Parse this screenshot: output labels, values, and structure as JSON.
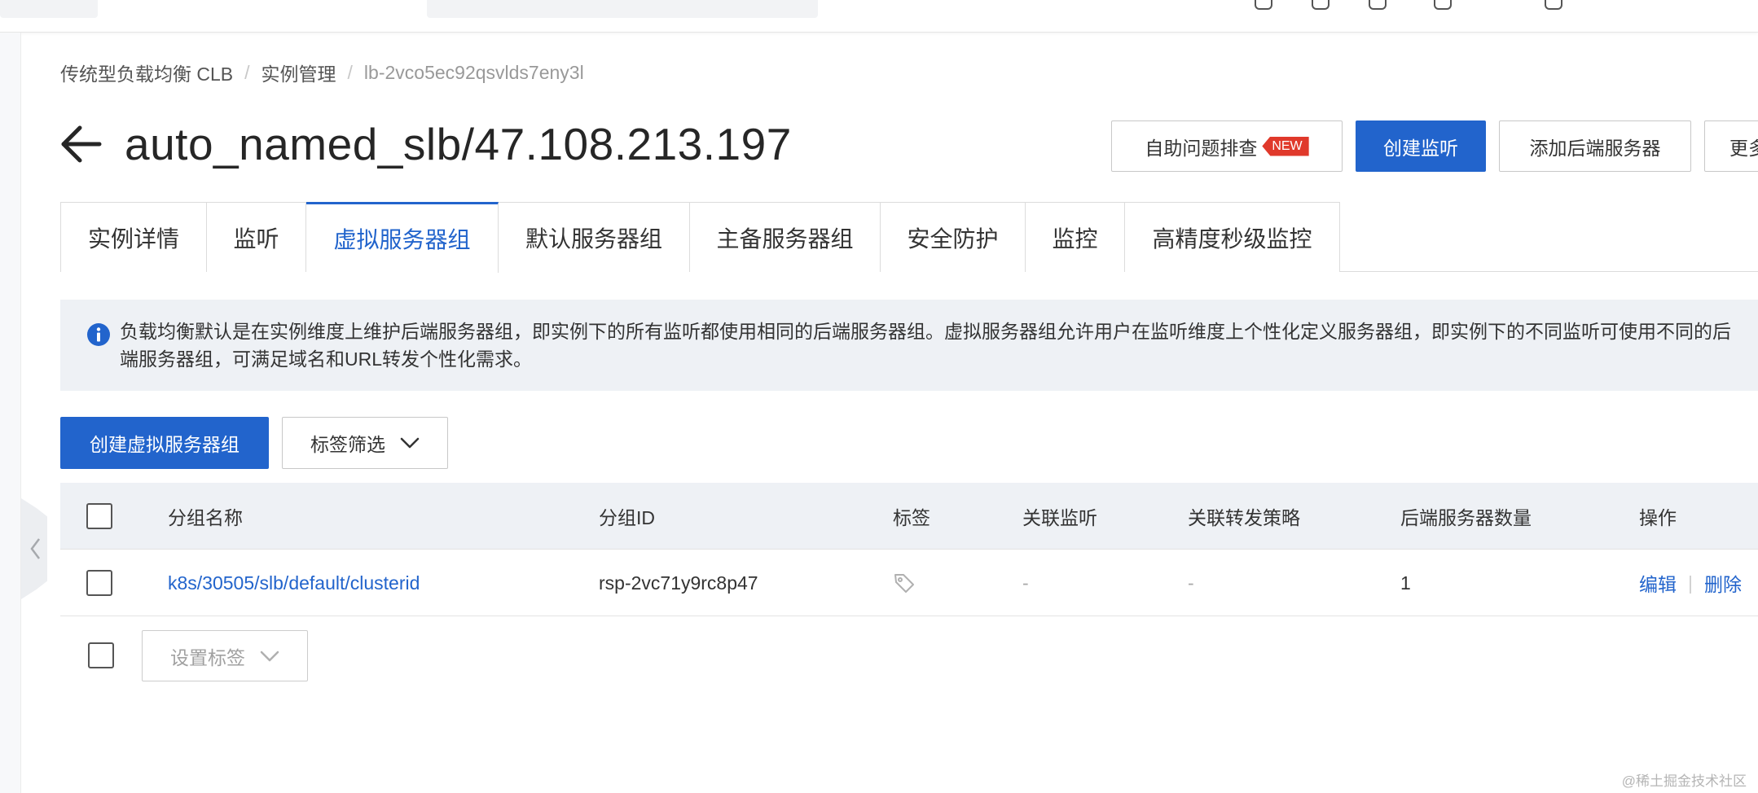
{
  "breadcrumb": {
    "items": [
      "传统型负载均衡 CLB",
      "实例管理",
      "lb-2vco5ec92qsvlds7eny3l"
    ],
    "separator": "/"
  },
  "header": {
    "title": "auto_named_slb/47.108.213.197",
    "self_check_label": "自助问题排查",
    "new_badge": "NEW",
    "create_listener_label": "创建监听",
    "add_backend_label": "添加后端服务器",
    "more_label": "更多"
  },
  "tabs": [
    {
      "label": "实例详情"
    },
    {
      "label": "监听"
    },
    {
      "label": "虚拟服务器组",
      "active": true
    },
    {
      "label": "默认服务器组"
    },
    {
      "label": "主备服务器组"
    },
    {
      "label": "安全防护"
    },
    {
      "label": "监控"
    },
    {
      "label": "高精度秒级监控"
    }
  ],
  "info": {
    "line1": "负载均衡默认是在实例维度上维护后端服务器组，即实例下的所有监听都使用相同的后端服务器组。虚拟服务器组允许用户在监听维度上个性化定义服务器组，即实例下的不同监听可使用不同的后",
    "line2": "端服务器组，可满足域名和URL转发个性化需求。"
  },
  "toolbar": {
    "create_group_label": "创建虚拟服务器组",
    "tag_filter_label": "标签筛选"
  },
  "table": {
    "headers": {
      "name": "分组名称",
      "id": "分组ID",
      "tags": "标签",
      "listeners": "关联监听",
      "policies": "关联转发策略",
      "backend_count": "后端服务器数量",
      "actions": "操作"
    },
    "rows": [
      {
        "name": "k8s/30505/slb/default/clusterid",
        "id": "rsp-2vc71y9rc8p47",
        "listeners": "-",
        "policies": "-",
        "backend_count": "1",
        "edit_label": "编辑",
        "delete_label": "删除"
      }
    ]
  },
  "footer": {
    "set_tag_label": "设置标签"
  },
  "watermark": "@稀土掘金技术社区",
  "colors": {
    "primary": "#2264cc",
    "badge": "#e0392b",
    "info_bg": "#eef1f5"
  },
  "icons": [
    "back-arrow-icon",
    "info-icon",
    "chevron-down-icon",
    "tag-icon",
    "chevron-left-icon"
  ]
}
